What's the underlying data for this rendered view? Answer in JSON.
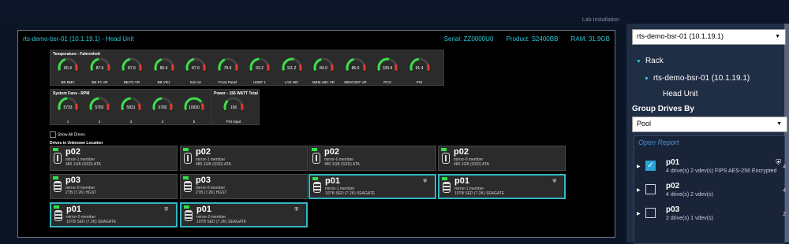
{
  "topbar": {
    "crumb": "Lab Installation"
  },
  "header": {
    "title": "rts-demo-bsr-01 (10.1.19.1)  -  Head Unit",
    "serial": "Serial:  ZZ0000U0",
    "product": "Product:  S2400BB",
    "ram": "RAM: 31.9GB"
  },
  "temperature": {
    "title": "Temperature - Fahrenheit",
    "gauges": [
      {
        "label": "BB BMC",
        "value": "80.4",
        "fill": 0.42
      },
      {
        "label": "BB P1 VR",
        "value": "87.6",
        "fill": 0.45
      },
      {
        "label": "BB P2 VR",
        "value": "87.6",
        "fill": 0.45
      },
      {
        "label": "BB VR1",
        "value": "80.4",
        "fill": 0.42
      },
      {
        "label": "Exit Air",
        "value": "87.6",
        "fill": 0.45
      },
      {
        "label": "Front Panel",
        "value": "78.6",
        "fill": 0.4
      },
      {
        "label": "HSBP 1",
        "value": "93.2",
        "fill": 0.48
      },
      {
        "label": "LAN NIC",
        "value": "111.2",
        "fill": 0.56
      },
      {
        "label": "MEM ABC VR",
        "value": "84.0",
        "fill": 0.43
      },
      {
        "label": "MEM DEF VR",
        "value": "86.0",
        "fill": 0.44
      },
      {
        "label": "PCH",
        "value": "109.4",
        "fill": 0.55
      },
      {
        "label": "PSI",
        "value": "91.4",
        "fill": 0.47
      }
    ]
  },
  "fans": {
    "title": "System Fans - RPM",
    "gauges": [
      {
        "label": "1",
        "value": "5733",
        "unit": "RPM",
        "fill": 0.48
      },
      {
        "label": "2",
        "value": "5782",
        "unit": "RPM",
        "fill": 0.48
      },
      {
        "label": "3",
        "value": "5831",
        "unit": "RPM",
        "fill": 0.49
      },
      {
        "label": "4",
        "value": "5782",
        "unit": "RPM",
        "fill": 0.48
      },
      {
        "label": "5",
        "value": "10920",
        "unit": "RPM",
        "fill": 0.75
      }
    ]
  },
  "power": {
    "title": "Power - 156 WATT Total",
    "gauges": [
      {
        "label": "PSI Input",
        "value": "156",
        "unit": "WATT",
        "fill": 0.3
      }
    ]
  },
  "show_all_drives": "Show All Drives",
  "drives_section": "Drives in Unknown Location",
  "drives": [
    {
      "pool": "p02",
      "line1": "mirror-1 member",
      "line2": "480.1GB (SSD) ATA",
      "type": "ssd",
      "selected": false,
      "shield": false
    },
    {
      "pool": "p02",
      "line1": "mirror-1 member",
      "line2": "480.1GB (SSD) ATA",
      "type": "ssd",
      "selected": false,
      "shield": false
    },
    {
      "pool": "p02",
      "line1": "mirror-0 member",
      "line2": "480.1GB (SSD) ATA",
      "type": "ssd",
      "selected": false,
      "shield": false
    },
    {
      "pool": "p02",
      "line1": "mirror-0 member",
      "line2": "480.1GB (SSD) ATA",
      "type": "ssd",
      "selected": false,
      "shield": false
    },
    {
      "pool": "p03",
      "line1": "mirror-0 member",
      "line2": "2TB (7.2K) HGST",
      "type": "hdd",
      "selected": false,
      "shield": false
    },
    {
      "pool": "p03",
      "line1": "mirror-0 member",
      "line2": "2TB (7.2K) HGST",
      "type": "hdd",
      "selected": false,
      "shield": false
    },
    {
      "pool": "p01",
      "line1": "mirror-1 member",
      "line2": "10TB SED (7.2K) SEAGATE",
      "type": "hdd",
      "selected": true,
      "shield": true
    },
    {
      "pool": "p01",
      "line1": "mirror-1 member",
      "line2": "10TB SED (7.2K) SEAGATE",
      "type": "hdd",
      "selected": true,
      "shield": true
    },
    {
      "pool": "p01",
      "line1": "mirror-0 member",
      "line2": "10TB SED (7.2K) SEAGATE",
      "type": "hdd",
      "selected": true,
      "shield": true
    },
    {
      "pool": "p01",
      "line1": "mirror-0 member",
      "line2": "10TB SED (7.2K) SEAGATE",
      "type": "hdd",
      "selected": true,
      "shield": true
    }
  ],
  "sidebar": {
    "system_select": "rts-demo-bsr-01 (10.1.19.1)",
    "tree": {
      "rack": "Rack",
      "host": "rts-demo-bsr-01 (10.1.19.1)",
      "unit": "Head Unit"
    },
    "group_label": "Group Drives By",
    "group_select": "Pool",
    "open_report": "Open Report",
    "pools": [
      {
        "name": "p01",
        "desc": "4 drive(s) 2 vdev(s) FIPS AES-256 Encrypted",
        "count": "4",
        "checked": true,
        "shield": true
      },
      {
        "name": "p02",
        "desc": "4 drive(s) 2 vdev(s)",
        "count": "4",
        "checked": false,
        "shield": false
      },
      {
        "name": "p03",
        "desc": "2 drive(s) 1 vdev(s)",
        "count": "2",
        "checked": false,
        "shield": false
      }
    ]
  }
}
